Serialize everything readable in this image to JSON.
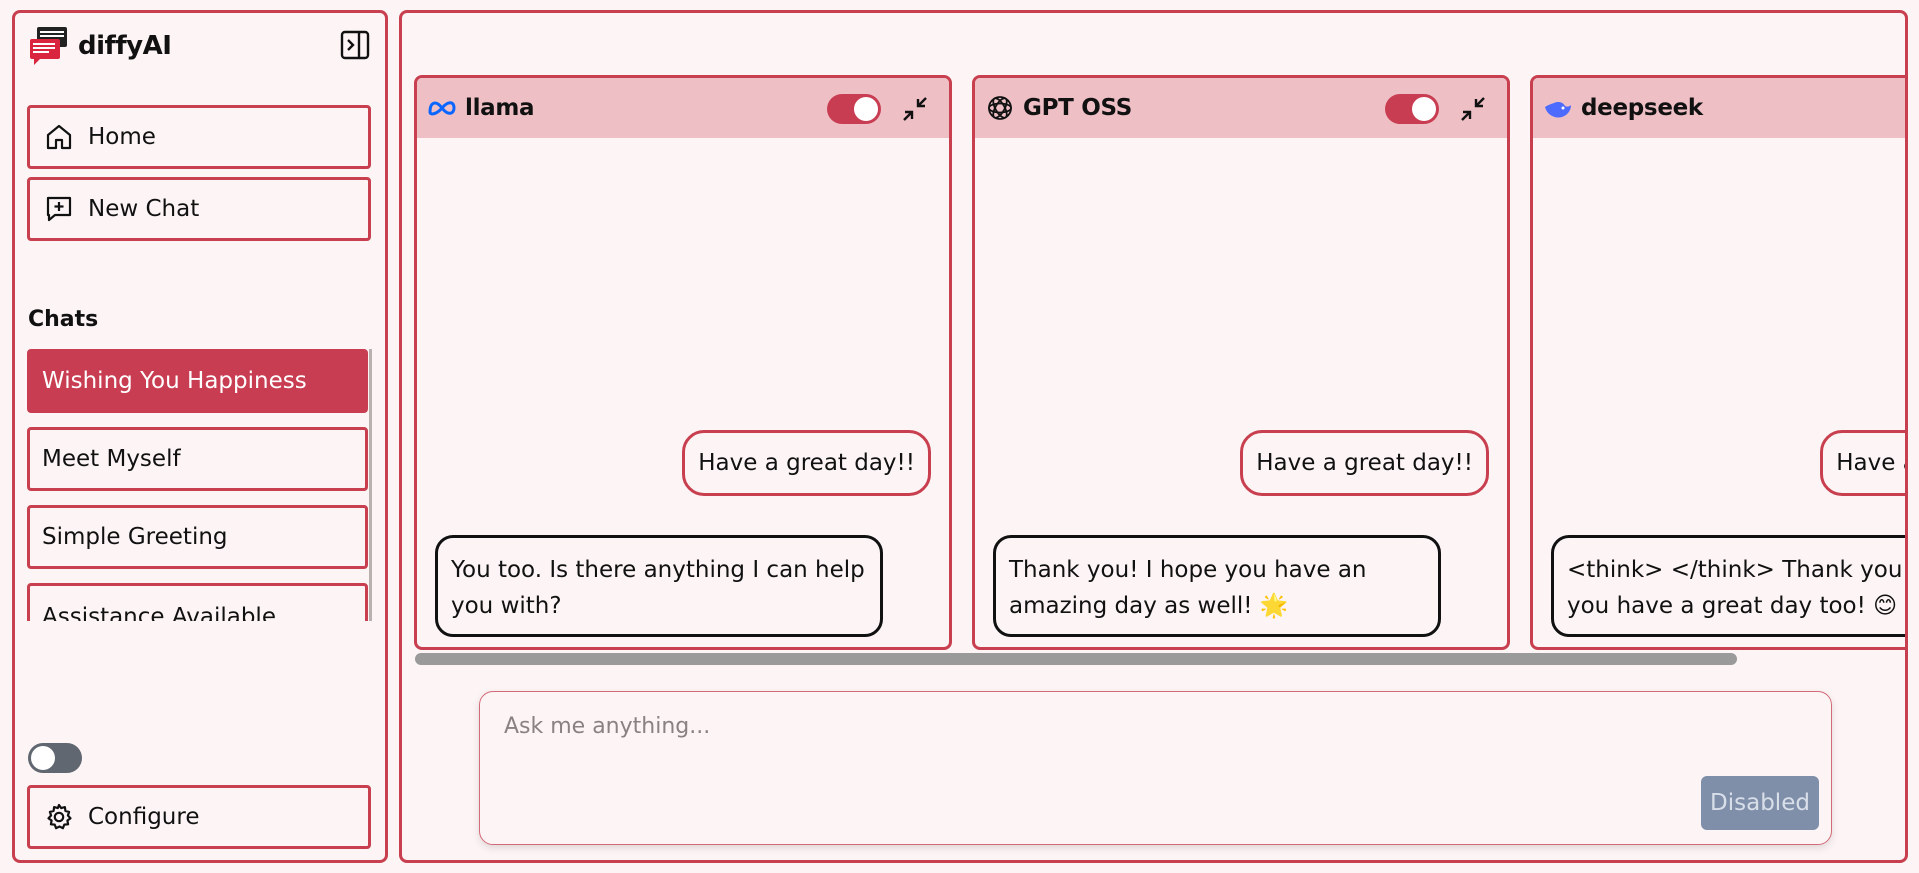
{
  "colors": {
    "accent": "#c93d52",
    "panel_header": "#eec0c6",
    "background": "#fdf5f5"
  },
  "sidebar": {
    "brand": "diffyAI",
    "home_label": "Home",
    "new_chat_label": "New Chat",
    "chats_title": "Chats",
    "chats": [
      {
        "label": "Wishing You Happiness",
        "active": true
      },
      {
        "label": "Meet Myself",
        "active": false
      },
      {
        "label": "Simple Greeting",
        "active": false
      },
      {
        "label": "Assistance Available",
        "active": false
      }
    ],
    "configure_label": "Configure"
  },
  "panels": [
    {
      "name": "llama",
      "icon": "meta-icon",
      "enabled": true,
      "user_message": "Have a great day!!",
      "assistant_message": "You too. Is there anything I can help you with?"
    },
    {
      "name": "GPT OSS",
      "icon": "openai-icon",
      "enabled": true,
      "user_message": "Have a great day!!",
      "assistant_message": "Thank you! I hope you have an amazing day as well! 🌟"
    },
    {
      "name": "deepseek",
      "icon": "deepseek-whale-icon",
      "enabled": true,
      "user_message": "Have a great day!!",
      "assistant_message": "<think> </think> Thank you! I hope you have a great day too! 😊"
    }
  ],
  "composer": {
    "placeholder": "Ask me anything...",
    "send_label": "Disabled"
  }
}
